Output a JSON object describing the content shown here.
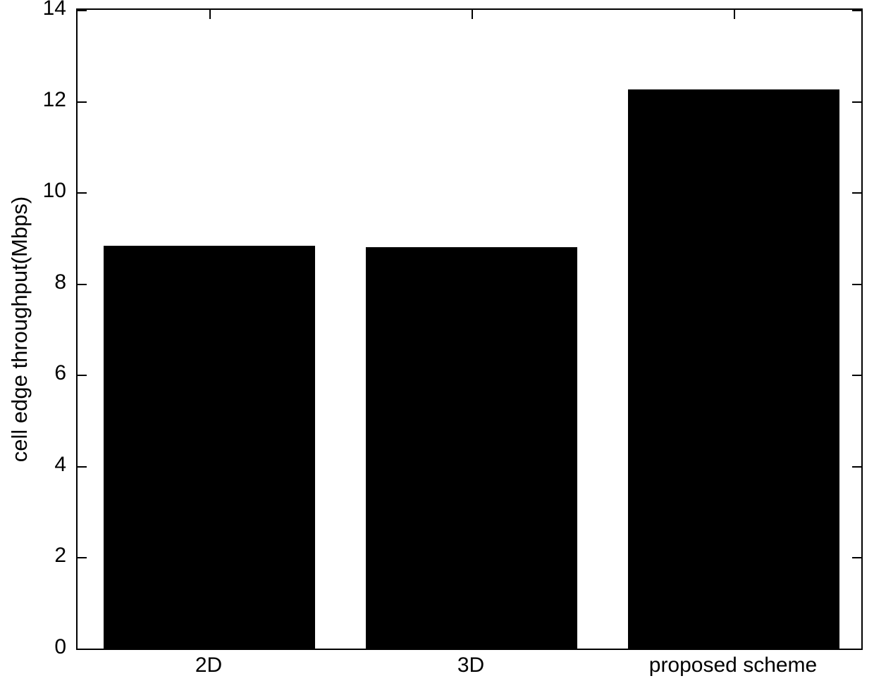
{
  "chart_data": {
    "type": "bar",
    "title": "",
    "xlabel": "",
    "ylabel": "cell edge throughput(Mbps)",
    "categories": [
      "2D",
      "3D",
      "proposed scheme"
    ],
    "values": [
      8.83,
      8.8,
      12.25
    ],
    "ylim": [
      0,
      14
    ],
    "yticks": [
      0,
      2,
      4,
      6,
      8,
      10,
      12,
      14
    ],
    "ytick_labels": [
      "0",
      "2",
      "4",
      "6",
      "8",
      "10",
      "12",
      "14"
    ],
    "xlim": [
      0.5,
      3.5
    ],
    "grid": false,
    "legend": null,
    "bar_color": "#000000",
    "axis_color": "#000000",
    "background_color": "#ffffff",
    "series": [
      {
        "name": "cell edge throughput",
        "values": [
          8.83,
          8.8,
          12.25
        ]
      }
    ]
  }
}
